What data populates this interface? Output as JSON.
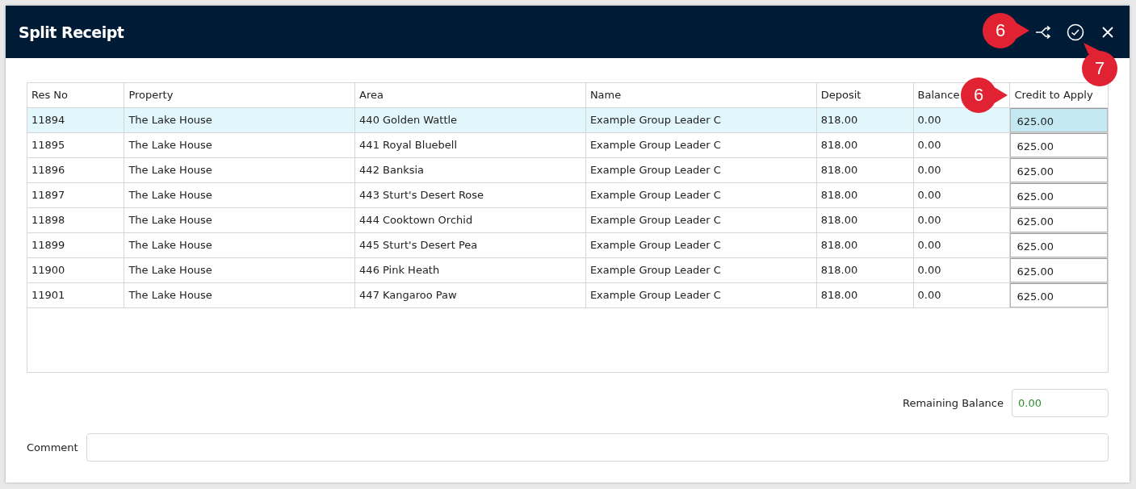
{
  "window": {
    "title": "Split Receipt"
  },
  "table": {
    "columns": [
      "Res No",
      "Property",
      "Area",
      "Name",
      "Deposit",
      "Balance",
      "Credit to Apply"
    ],
    "rows": [
      {
        "cells": [
          "11894",
          "The Lake House",
          "440 Golden Wattle",
          "Example Group Leader C",
          "818.00",
          "0.00"
        ],
        "credit": "625.00",
        "selected": true
      },
      {
        "cells": [
          "11895",
          "The Lake House",
          "441 Royal Bluebell",
          "Example Group Leader C",
          "818.00",
          "0.00"
        ],
        "credit": "625.00",
        "selected": false
      },
      {
        "cells": [
          "11896",
          "The Lake House",
          "442 Banksia",
          "Example Group Leader C",
          "818.00",
          "0.00"
        ],
        "credit": "625.00",
        "selected": false
      },
      {
        "cells": [
          "11897",
          "The Lake House",
          "443 Sturt's Desert Rose",
          "Example Group Leader C",
          "818.00",
          "0.00"
        ],
        "credit": "625.00",
        "selected": false
      },
      {
        "cells": [
          "11898",
          "The Lake House",
          "444 Cooktown Orchid",
          "Example Group Leader C",
          "818.00",
          "0.00"
        ],
        "credit": "625.00",
        "selected": false
      },
      {
        "cells": [
          "11899",
          "The Lake House",
          "445 Sturt's Desert Pea",
          "Example Group Leader C",
          "818.00",
          "0.00"
        ],
        "credit": "625.00",
        "selected": false
      },
      {
        "cells": [
          "11900",
          "The Lake House",
          "446 Pink Heath",
          "Example Group Leader C",
          "818.00",
          "0.00"
        ],
        "credit": "625.00",
        "selected": false
      },
      {
        "cells": [
          "11901",
          "The Lake House",
          "447 Kangaroo Paw",
          "Example Group Leader C",
          "818.00",
          "0.00"
        ],
        "credit": "625.00",
        "selected": false
      }
    ]
  },
  "remaining_balance": {
    "label": "Remaining Balance",
    "value": "0.00"
  },
  "comment": {
    "label": "Comment"
  },
  "annotations": [
    {
      "label": "6"
    },
    {
      "label": "7"
    },
    {
      "label": "6"
    }
  ]
}
